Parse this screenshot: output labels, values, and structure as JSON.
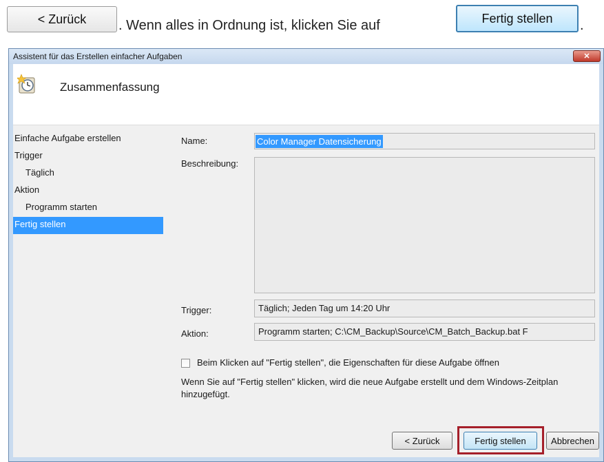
{
  "instruction": {
    "back_label": "< Zurück",
    "text": ". Wenn alles in Ordnung ist, klicken Sie auf",
    "finish_label": "Fertig stellen",
    "end": "."
  },
  "window": {
    "title": "Assistent für das Erstellen einfacher Aufgaben",
    "close_glyph": "✕"
  },
  "header": {
    "icon": "task-clock-icon",
    "title": "Zusammenfassung"
  },
  "nav": {
    "items": [
      {
        "label": "Einfache Aufgabe erstellen"
      },
      {
        "label": "Trigger"
      },
      {
        "label": "Täglich"
      },
      {
        "label": "Aktion"
      },
      {
        "label": "Programm starten"
      },
      {
        "label": "Fertig stellen"
      }
    ]
  },
  "form": {
    "name_label": "Name:",
    "name_value": "Color Manager Datensicherung",
    "description_label": "Beschreibung:",
    "description_value": "",
    "trigger_label": "Trigger:",
    "trigger_value": "Täglich; Jeden Tag um 14:20 Uhr",
    "action_label": "Aktion:",
    "action_value": "Programm starten; C:\\CM_Backup\\Source\\CM_Batch_Backup.bat F",
    "checkbox_label": "Beim Klicken auf \"Fertig stellen\", die Eigenschaften für diese Aufgabe öffnen",
    "checkbox_checked": false,
    "info_text": "Wenn Sie auf \"Fertig stellen\" klicken, wird die neue Aufgabe erstellt und dem Windows-Zeitplan hinzugefügt."
  },
  "buttons": {
    "back": "< Zurück",
    "finish": "Fertig stellen",
    "cancel": "Abbrechen"
  },
  "colors": {
    "selection": "#3399ff",
    "highlight_frame": "#a51f2a",
    "window_frame": "#c9dbef"
  }
}
